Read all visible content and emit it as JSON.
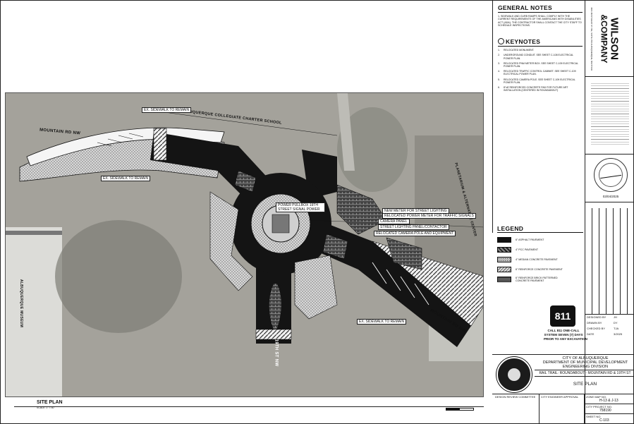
{
  "general_notes": {
    "heading": "GENERAL NOTES",
    "items": [
      "1.  SIDEWALK AND CURB RAMPS SHALL COMPLY WITH THE CURRENT REQUIREMENTS OF THE AMERICANS WITH DISABILITIES ACT (ADA). THE CONTRACTOR SHALL CONTACT THE CITY STAFF TO SCHEDULE INSPECTIONS."
    ]
  },
  "keynotes": {
    "heading": "KEYNOTES",
    "items": [
      {
        "n": "1.",
        "text": "RELOCATED MONUMENT."
      },
      {
        "n": "2.",
        "text": "UNDERGROUND CONDUIT. SEE SHEET C-108 ELECTRICAL POWER PLAN."
      },
      {
        "n": "3.",
        "text": "RELOCATED PNM METER BOX. SEE SHEET C-109 ELECTRICAL POWER PLAN."
      },
      {
        "n": "4.",
        "text": "RELOCATED TRAFFIC CONTROL CABINET. SEE SHEET C-109 ELECTRICAL POWER PLAN."
      },
      {
        "n": "5.",
        "text": "RELOCATED CAMERA POLE. SEE SHEET C-109 ELECTRICAL POWER PLAN."
      },
      {
        "n": "6.",
        "text": "8\"x8' REINFORCED CONCRETE PAD FOR FUTURE ART INSTALLATION (CENTERED IN ROUNDABOUT)"
      }
    ]
  },
  "legend": {
    "heading": "LEGEND",
    "items": [
      {
        "label": "6\" ASPHALT PAVEMENT",
        "color": "#111111"
      },
      {
        "label": "4\" PCC PAVEMENT",
        "color": "#555555"
      },
      {
        "label": "4\" MEDIAN CONCRETE PAVEMENT",
        "color": "#bdbdbd"
      },
      {
        "label": "6\" REINFORCE CONCRETE PAVEMENT",
        "color": "#8a8a8a"
      },
      {
        "label": "6\" REINFORCE BRICK PATTERNED CONCRETE PAVEMENT",
        "color": "#6a6a6a"
      }
    ]
  },
  "plan": {
    "street_labels": {
      "mountain_west": "MOUNTAIN RD NW",
      "mountain_east": "MOUNTAIN RD NW",
      "nineteenth": "19TH ST NW",
      "charter_school": "ALBUQUERQUE COLLEGIATE CHARTER SCHOOL",
      "museum": "ALBUQUERQUE MUSEUM",
      "planetarium": "PLANETARIUM & ALTERNATIVE CENTER"
    },
    "callouts": [
      "EX. SIDEWALK TO REMAIN",
      "EX. SIDEWALK TO REMAIN",
      "EX. SIDEWALK TO REMAIN",
      "POWER PULLBOX 19TH STREET SIGNAL POWER",
      "NEW METER FOR STREET LIGHTING",
      "RELOCATED POWER METER FOR TRAFFIC SIGNALS",
      "CAMERA PANEL",
      "STREET LIGHTING PANEL/CONTACTOR",
      "RELOCATED CAMERA POLE AND EQUIPMENT"
    ]
  },
  "bottom": {
    "title": "SITE PLAN",
    "scale": "SCALE: 1\" = 40'"
  },
  "firm": {
    "name_line1": "WILSON",
    "name_line2": "&COMPANY",
    "address": "4401 MASTHEAD ST. NE, SUITE 150 ALBUQUERQUE, NM 87109"
  },
  "callnotice": {
    "logo": "811",
    "lines": [
      "CALL 811 ONE-CALL",
      "SYSTEM SEVEN (7) DAYS",
      "PRIOR TO ANY EXCAVATION"
    ]
  },
  "titleblock": {
    "city": "CITY OF ALBUQUERQUE",
    "dept": "DEPARTMENT OF MUNICIPAL DEVELOPMENT",
    "div": "ENGINEERING DIVISION",
    "project": "RAIL TRAIL: ROUNDABOUT - MOUNTAIN RD & 19TH ST",
    "sheet_title": "SITE PLAN",
    "designed_by_label": "DESIGNED BY",
    "designed_by": "JH",
    "drawn_by_label": "DRAWN BY",
    "drawn_by": "DY",
    "checked_by_label": "CHECKED BY",
    "checked_by": "TJA",
    "date_label": "DATE",
    "date": "3/2025",
    "review_committee": "DESIGN REVIEW COMMITTEE",
    "engineer_approval": "CITY ENGINEER APPROVAL",
    "zone_map_label": "ZONE MAP NO.",
    "zone_map": "H-13 & J-13",
    "project_no_label": "CITY PROJECT NO.",
    "project_no": "758190",
    "sheet_no_label": "SHEET NO.",
    "sheet_no": "C-103",
    "seal_date": "03/04/2025"
  }
}
